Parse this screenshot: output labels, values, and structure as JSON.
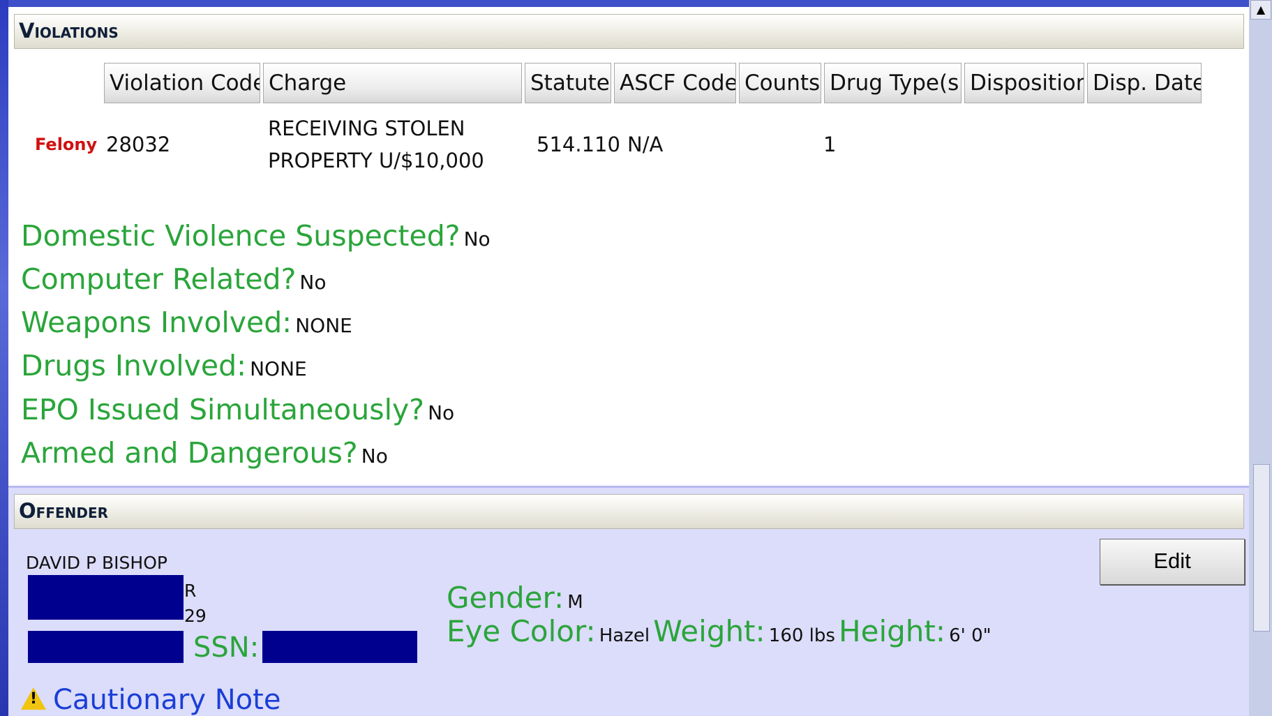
{
  "violations": {
    "title": "Violations",
    "columns": [
      "Violation Code",
      "Charge",
      "Statute",
      "ASCF Code",
      "Counts",
      "Drug Type(s)",
      "Disposition",
      "Disp. Date"
    ],
    "row": {
      "level": "Felony",
      "code": "28032",
      "charge_line1": "RECEIVING STOLEN",
      "charge_line2": "PROPERTY U/$10,000",
      "statute": "514.110",
      "ascf_code": "N/A",
      "counts": "1"
    }
  },
  "details": [
    {
      "label": "Domestic Violence Suspected?",
      "value": "No"
    },
    {
      "label": "Computer Related?",
      "value": "No"
    },
    {
      "label": "Weapons Involved:",
      "value": "NONE"
    },
    {
      "label": "Drugs Involved:",
      "value": "NONE"
    },
    {
      "label": "EPO Issued Simultaneously?",
      "value": "No"
    },
    {
      "label": "Armed and Dangerous?",
      "value": "No"
    }
  ],
  "offender": {
    "title": "Offender",
    "edit_label": "Edit",
    "name": "DAVID P BISHOP",
    "addr_fragment_1": "R",
    "addr_fragment_2": "29",
    "ssn_label": "SSN:",
    "gender_label": "Gender:",
    "gender_value": "M",
    "eye_label": "Eye Color:",
    "eye_value": "Hazel",
    "weight_label": "Weight:",
    "weight_value": "160 lbs",
    "height_label": "Height:",
    "height_value": "6' 0\"",
    "caution_label": "Cautionary Note"
  },
  "colors": {
    "label_green": "#2aa53a",
    "felony_red": "#d01010",
    "redaction_blue": "#00008f",
    "offender_bg": "#dcdcfb",
    "link_blue": "#1a3fd6"
  },
  "icons": {
    "scroll_up": "up-arrow-icon",
    "caution": "warning-triangle-icon"
  }
}
